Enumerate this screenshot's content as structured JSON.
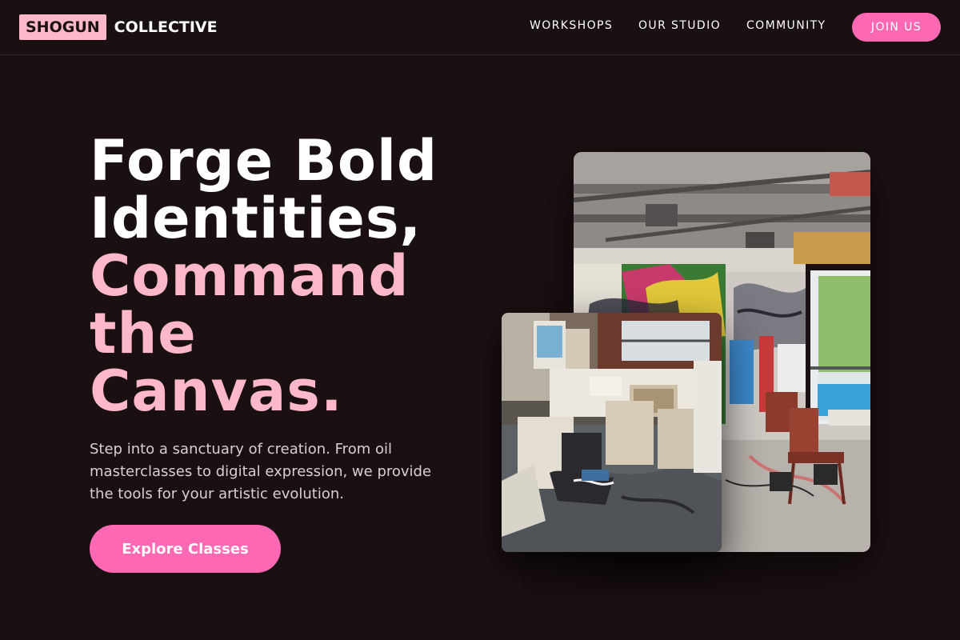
{
  "brand": {
    "highlight": "SHOGUN",
    "name": "COLLECTIVE"
  },
  "nav": {
    "links": [
      "WORKSHOPS",
      "OUR STUDIO",
      "COMMUNITY"
    ],
    "cta_label": "JOIN US"
  },
  "hero": {
    "headline_white": [
      "Forge Bold",
      "Identities,"
    ],
    "headline_pink": [
      "Command",
      "the",
      "Canvas."
    ],
    "description": "Step into a sanctuary of creation. From oil masterclasses to digital expression, we provide the tools for your artistic evolution.",
    "cta_label": "Explore Classes"
  },
  "images": {
    "back": "studio-loft-graffiti-photo",
    "front": "art-studio-workspace-photo"
  },
  "colors": {
    "background": "#1a1012",
    "accent_pink": "#ff69b4",
    "soft_pink": "#ffb8c9",
    "text_white": "#ffffff",
    "text_muted": "#d9cfd1"
  }
}
